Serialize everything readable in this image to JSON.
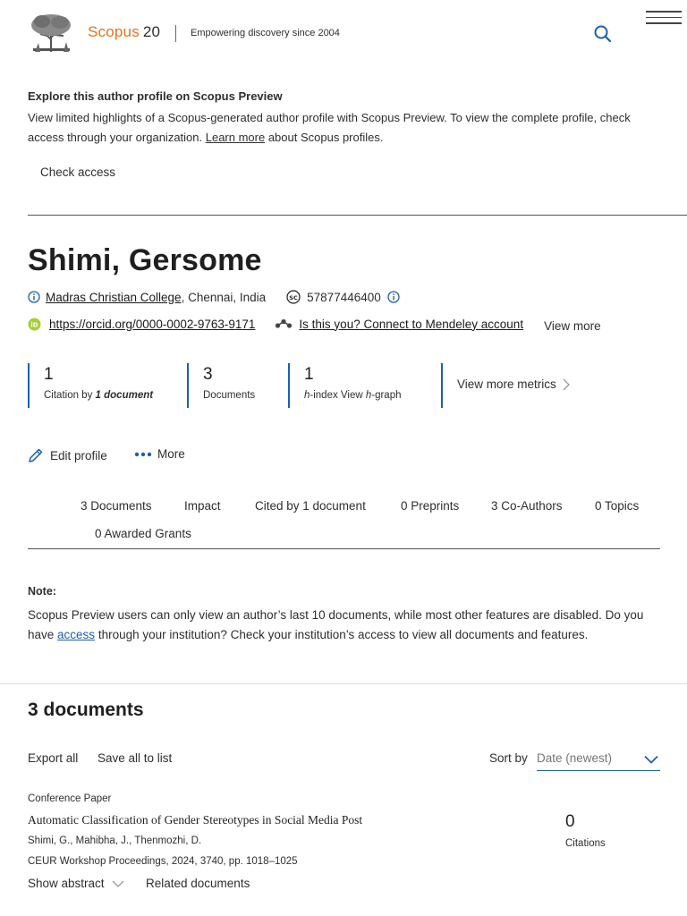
{
  "header": {
    "brand": "Scopus",
    "version": "20",
    "tagline": "Empowering discovery since 2004",
    "search_icon": "search-icon",
    "menu_icon": "hamburger-menu-icon"
  },
  "preview_banner": {
    "title": "Explore this author profile on Scopus Preview",
    "text_before_link": "View limited highlights of a Scopus-generated author profile with Scopus Preview. To view the complete profile, check access through your organization. ",
    "link_text": "Learn more",
    "text_after_link": " about Scopus profiles.",
    "check_access": "Check access"
  },
  "author": {
    "name": "Shimi, Gersome",
    "affiliation_link": "Madras Christian College",
    "affiliation_rest": ", Chennai, India",
    "scopus_id": "57877446400",
    "orcid_url": "https://orcid.org/0000-0002-9763-9171",
    "mendeley_link": "Is this you? Connect to Mendeley account",
    "view_more": "View more"
  },
  "metrics": {
    "citations": {
      "value": "1",
      "label_prefix": "Citation by ",
      "label_emph": "1 document"
    },
    "documents": {
      "value": "3",
      "label": "Documents"
    },
    "h_index": {
      "value": "1",
      "label_h": "h",
      "label_mid": "-index View ",
      "label_h2": "h",
      "label_end": "-graph"
    },
    "view_more_metrics": "View more metrics"
  },
  "actions": {
    "edit_profile": "Edit profile",
    "more": "More"
  },
  "tabs": [
    "3 Documents",
    "Impact",
    "Cited by 1 document",
    "0 Preprints",
    "3 Co-Authors",
    "0 Topics",
    "0 Awarded Grants"
  ],
  "note": {
    "title": "Note:",
    "text_before_link": "Scopus Preview users can only view an author’s last 10 documents, while most other features are disabled. Do you have ",
    "link_text": "access",
    "text_after_link": " through your institution? Check your institution’s access to view all documents and features."
  },
  "documents": {
    "heading": "3 documents",
    "export_all": "Export all",
    "save_all": "Save all to list",
    "sort_label": "Sort by",
    "sort_value": "Date (newest)",
    "items": [
      {
        "type": "Conference Paper",
        "title": "Automatic Classification of Gender Stereotypes in Social Media Post",
        "authors": "Shimi, G., Mahibha, J., Thenmozhi, D.",
        "source": "CEUR Workshop Proceedings, 2024, 3740, pp. 1018–1025",
        "citations": "0",
        "citations_label": "Citations",
        "show_abstract": "Show abstract",
        "related_documents": "Related documents"
      }
    ]
  },
  "colors": {
    "brand_orange": "#e9711c",
    "link_blue": "#1a5fb4",
    "orcid_green": "#a6ce39"
  }
}
